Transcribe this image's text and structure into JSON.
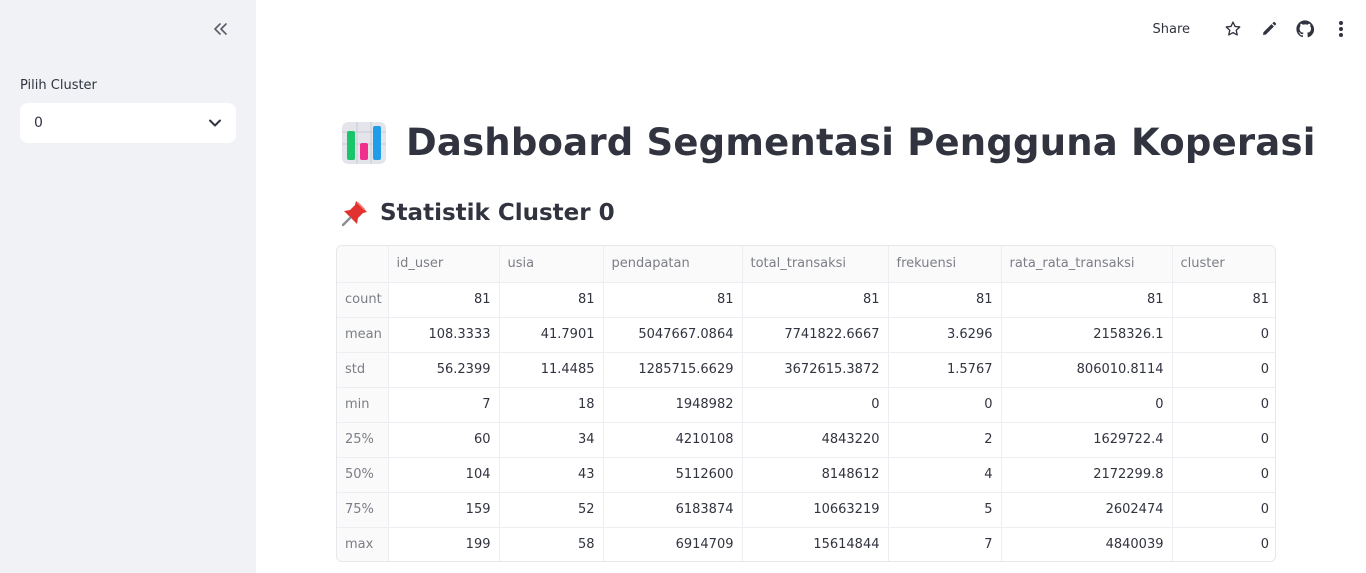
{
  "sidebar": {
    "select_label": "Pilih Cluster",
    "select_value": "0"
  },
  "toolbar": {
    "share_label": "Share"
  },
  "main": {
    "title": "Dashboard Segmentasi Pengguna Koperasi",
    "subheader": "Statistik Cluster 0"
  },
  "table": {
    "columns": [
      "",
      "id_user",
      "usia",
      "pendapatan",
      "total_transaksi",
      "frekuensi",
      "rata_rata_transaksi",
      "cluster"
    ],
    "rows": [
      [
        "count",
        "81",
        "81",
        "81",
        "81",
        "81",
        "81",
        "81"
      ],
      [
        "mean",
        "108.3333",
        "41.7901",
        "5047667.0864",
        "7741822.6667",
        "3.6296",
        "2158326.1",
        "0"
      ],
      [
        "std",
        "56.2399",
        "11.4485",
        "1285715.6629",
        "3672615.3872",
        "1.5767",
        "806010.8114",
        "0"
      ],
      [
        "min",
        "7",
        "18",
        "1948982",
        "0",
        "0",
        "0",
        "0"
      ],
      [
        "25%",
        "60",
        "34",
        "4210108",
        "4843220",
        "2",
        "1629722.4",
        "0"
      ],
      [
        "50%",
        "104",
        "43",
        "5112600",
        "8148612",
        "4",
        "2172299.8",
        "0"
      ],
      [
        "75%",
        "159",
        "52",
        "6183874",
        "10663219",
        "5",
        "2602474",
        "0"
      ],
      [
        "max",
        "199",
        "58",
        "6914709",
        "15614844",
        "7",
        "4840039",
        "0"
      ]
    ]
  },
  "icons": {
    "collapse": "double-chevron-left-icon",
    "select_arrow": "chevron-down-icon",
    "star": "star-icon",
    "edit": "pencil-icon",
    "github": "github-icon",
    "menu": "more-vertical-icon",
    "title_emoji": "bar-chart-emoji-icon",
    "subheader_emoji": "pushpin-emoji-icon"
  }
}
